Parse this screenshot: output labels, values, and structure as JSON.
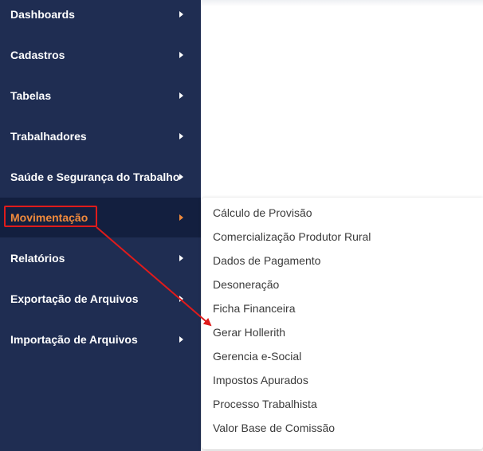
{
  "sidebar": {
    "items": [
      {
        "label": "Dashboards"
      },
      {
        "label": "Cadastros"
      },
      {
        "label": "Tabelas"
      },
      {
        "label": "Trabalhadores"
      },
      {
        "label": "Saúde e Segurança do Trabalho"
      },
      {
        "label": "Movimentação",
        "active": true
      },
      {
        "label": "Relatórios"
      },
      {
        "label": "Exportação de Arquivos"
      },
      {
        "label": "Importação de Arquivos"
      }
    ]
  },
  "submenu": {
    "items": [
      {
        "label": "Cálculo de Provisão"
      },
      {
        "label": "Comercialização Produtor Rural"
      },
      {
        "label": "Dados de Pagamento"
      },
      {
        "label": "Desoneração"
      },
      {
        "label": "Ficha Financeira"
      },
      {
        "label": "Gerar Hollerith"
      },
      {
        "label": "Gerencia e-Social"
      },
      {
        "label": "Impostos Apurados"
      },
      {
        "label": "Processo Trabalhista"
      },
      {
        "label": "Valor Base de Comissão"
      }
    ]
  },
  "colors": {
    "sidebar_bg": "#1f2d52",
    "active_bg": "#131f3f",
    "active_text": "#f08a3c",
    "annotation": "#e01b1b"
  }
}
